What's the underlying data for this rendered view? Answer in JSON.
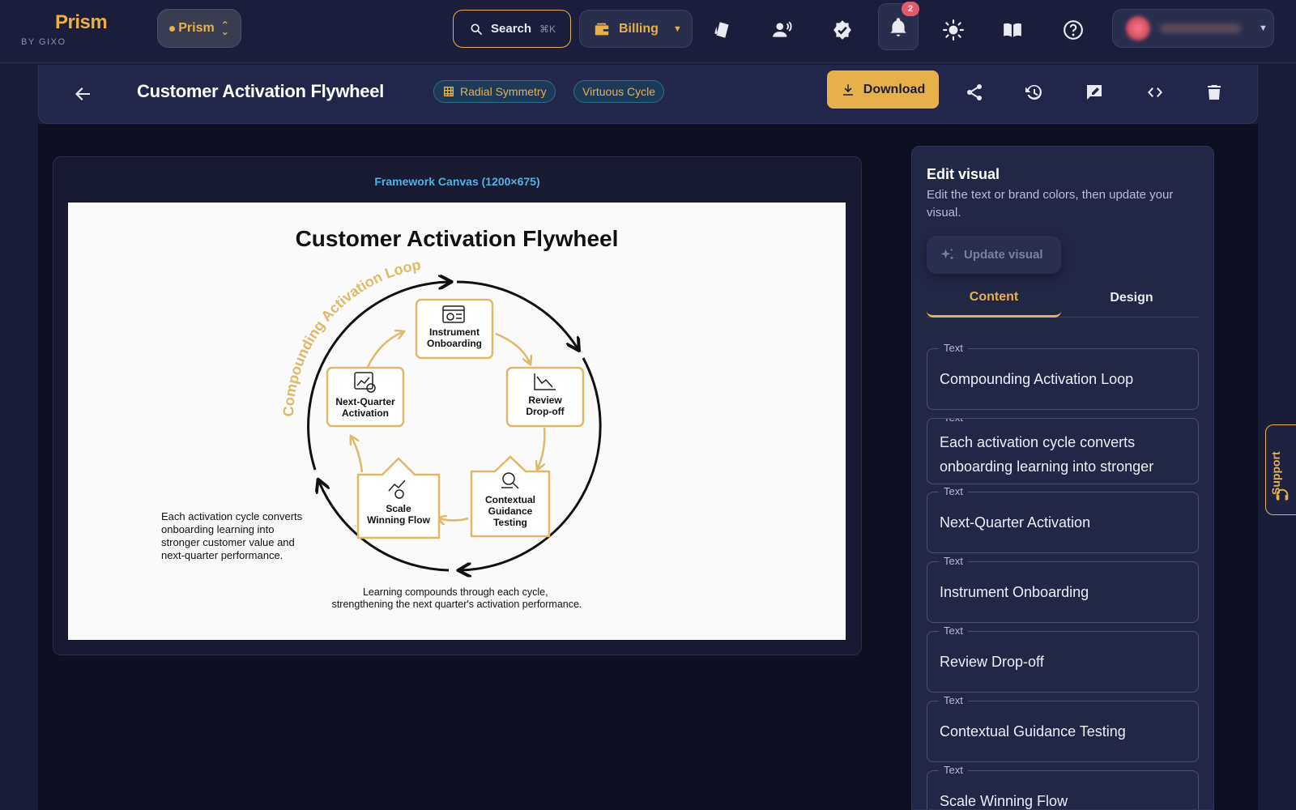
{
  "app": {
    "brand": "Prism",
    "byline": "BY GIXO",
    "workspace": "Prism",
    "search_label": "Search",
    "search_shortcut": "⌘K",
    "billing_label": "Billing",
    "notification_count": "2"
  },
  "titlebar": {
    "title": "Customer Activation Flywheel",
    "tags": [
      "Radial Symmetry",
      "Virtuous Cycle"
    ],
    "download_label": "Download"
  },
  "canvas": {
    "label": "Framework Canvas (1200×675)",
    "diagram": {
      "title": "Customer Activation Flywheel",
      "arc_label": "Compounding Activation Loop",
      "nodes": [
        {
          "line1": "Instrument",
          "line2": "Onboarding",
          "line3": ""
        },
        {
          "line1": "Review",
          "line2": "Drop-off",
          "line3": ""
        },
        {
          "line1": "Contextual",
          "line2": "Guidance",
          "line3": "Testing"
        },
        {
          "line1": "Scale",
          "line2": "Winning Flow",
          "line3": ""
        },
        {
          "line1": "Next-Quarter",
          "line2": "Activation",
          "line3": ""
        }
      ],
      "side_note": [
        "Each activation cycle converts",
        "onboarding learning into",
        "stronger customer value and",
        "next-quarter performance."
      ],
      "footer": [
        "Learning compounds through each cycle,",
        "strengthening the next quarter's activation performance."
      ]
    }
  },
  "panel": {
    "title": "Edit visual",
    "description": "Edit the text or brand colors, then update your visual.",
    "update_label": "Update visual",
    "tabs": [
      "Content",
      "Design"
    ],
    "field_label": "Text",
    "fields": [
      "Compounding Activation Loop",
      "Each activation cycle converts onboarding learning into stronger customer value and next-quarter performance.",
      "Next-Quarter Activation",
      "Instrument Onboarding",
      "Review Drop-off",
      "Contextual Guidance Testing",
      "Scale Winning Flow"
    ]
  },
  "support_label": "Support",
  "colors": {
    "accent": "#e8b04a",
    "background": "#1a1d38",
    "canvas_label": "#4fb3e8",
    "tag_border": "#2a6e8a"
  }
}
